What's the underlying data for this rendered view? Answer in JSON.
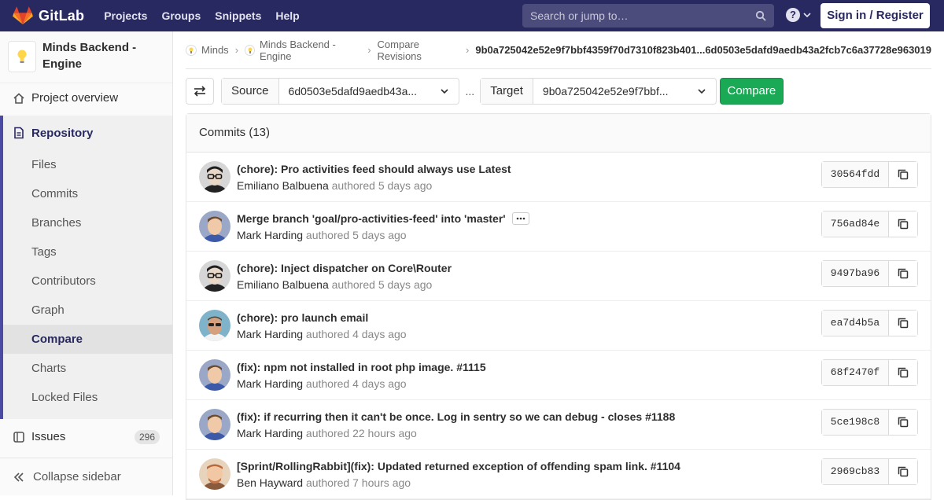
{
  "navbar": {
    "brand": "GitLab",
    "links": [
      "Projects",
      "Groups",
      "Snippets",
      "Help"
    ],
    "search_placeholder": "Search or jump to…",
    "signin_label": "Sign in / Register"
  },
  "sidebar": {
    "project_name": "Minds Backend - Engine",
    "overview_label": "Project overview",
    "repository_label": "Repository",
    "repo_items": [
      "Files",
      "Commits",
      "Branches",
      "Tags",
      "Contributors",
      "Graph",
      "Compare",
      "Charts",
      "Locked Files"
    ],
    "active_item": "Compare",
    "issues_label": "Issues",
    "issues_count": "296",
    "collapse_label": "Collapse sidebar"
  },
  "breadcrumb": {
    "items": [
      "Minds",
      "Minds Backend - Engine",
      "Compare Revisions"
    ],
    "current": "9b0a725042e52e9f7bbf4359f70d7310f823b401...6d0503e5dafd9aedb43a2fcb7c6a37728e963019"
  },
  "compare": {
    "source_label": "Source",
    "source_value": "6d0503e5dafd9aedb43a...",
    "separator": "...",
    "target_label": "Target",
    "target_value": "9b0a725042e52e9f7bbf...",
    "button_label": "Compare"
  },
  "commits": {
    "header": "Commits (13)",
    "authored_word": "authored",
    "items": [
      {
        "title": "(chore): Pro activities feed should always use Latest",
        "author": "Emiliano Balbuena",
        "time": "5 days ago",
        "sha": "30564fdd",
        "has_more": false,
        "avatar": "glasses"
      },
      {
        "title": "Merge branch 'goal/pro-activities-feed' into 'master'",
        "author": "Mark Harding",
        "time": "5 days ago",
        "sha": "756ad84e",
        "has_more": true,
        "avatar": "mark"
      },
      {
        "title": "(chore): Inject dispatcher on Core\\Router",
        "author": "Emiliano Balbuena",
        "time": "5 days ago",
        "sha": "9497ba96",
        "has_more": false,
        "avatar": "glasses"
      },
      {
        "title": "(chore): pro launch email",
        "author": "Mark Harding",
        "time": "4 days ago",
        "sha": "ea7d4b5a",
        "has_more": false,
        "avatar": "sunglasses"
      },
      {
        "title": "(fix): npm not installed in root php image. #1115",
        "author": "Mark Harding",
        "time": "4 days ago",
        "sha": "68f2470f",
        "has_more": false,
        "avatar": "mark"
      },
      {
        "title": "(fix): if recurring then it can't be once. Log in sentry so we can debug - closes #1188",
        "author": "Mark Harding",
        "time": "22 hours ago",
        "sha": "5ce198c8",
        "has_more": false,
        "avatar": "mark"
      },
      {
        "title": "[Sprint/RollingRabbit](fix): Updated returned exception of offending spam link. #1104",
        "author": "Ben Hayward",
        "time": "7 hours ago",
        "sha": "2969cb83",
        "has_more": false,
        "avatar": "ben"
      }
    ]
  },
  "colors": {
    "navbar": "#292961",
    "accent": "#4b4ba3",
    "compare_button": "#1aaa55"
  }
}
